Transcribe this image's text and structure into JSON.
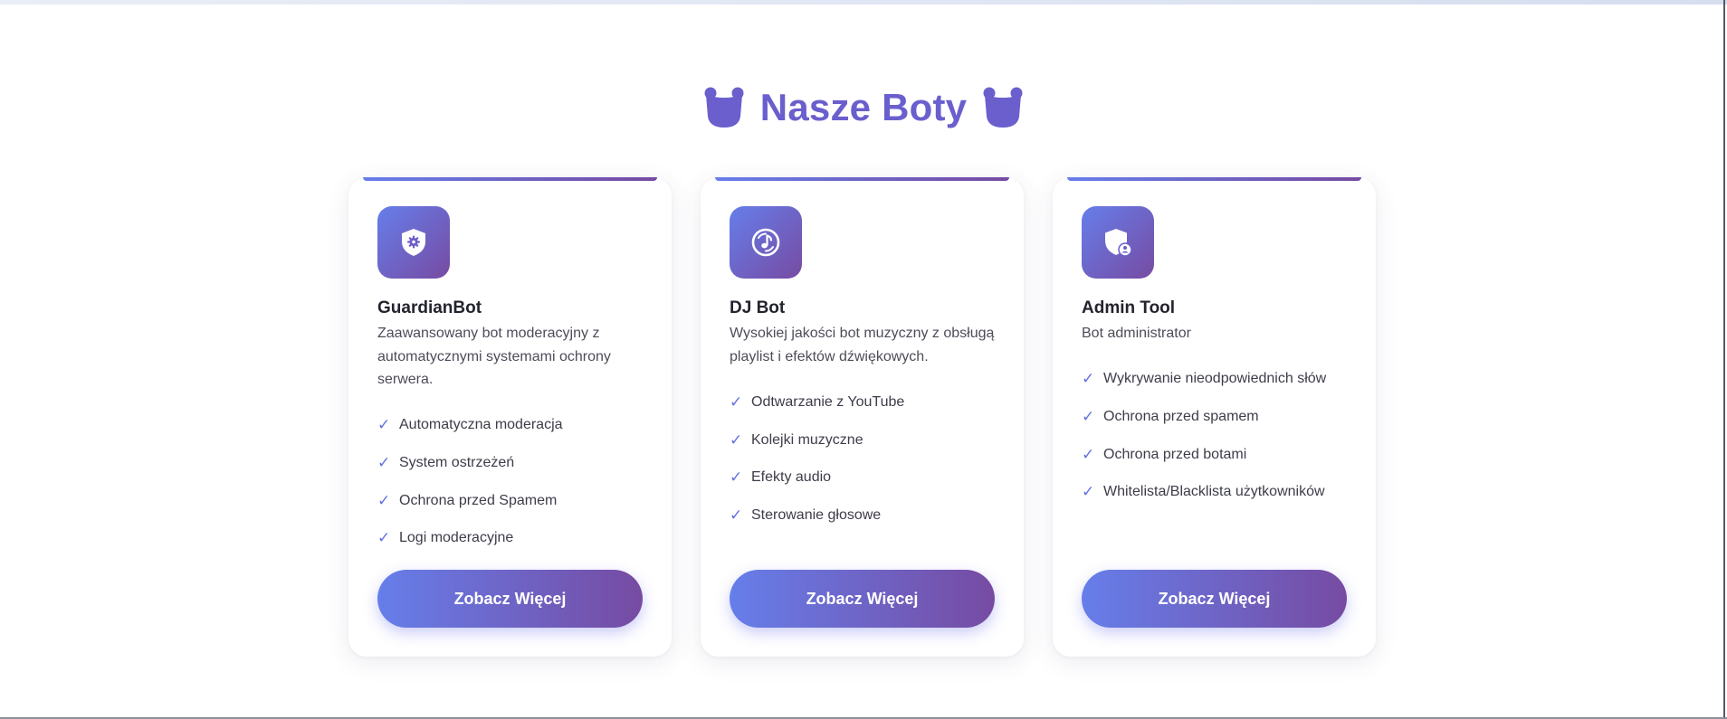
{
  "section": {
    "title": "Nasze Boty"
  },
  "icons": {
    "title_left": "robot-icon",
    "title_right": "robot-icon"
  },
  "colors": {
    "accent_start": "#667eea",
    "accent_end": "#764ba2",
    "title": "#6a5fcd"
  },
  "bots": [
    {
      "icon": "shield-gear-icon",
      "name": "GuardianBot",
      "description": "Zaawansowany bot moderacyjny z automatycznymi systemami ochrony serwera.",
      "features": [
        "Automatyczna moderacja",
        "System ostrzeżeń",
        "Ochrona przed Spamem",
        "Logi moderacyjne"
      ],
      "button": "Zobacz Więcej"
    },
    {
      "icon": "music-disc-icon",
      "name": "DJ Bot",
      "description": "Wysokiej jakości bot muzyczny z obsługą playlist i efektów dźwiękowych.",
      "features": [
        "Odtwarzanie z YouTube",
        "Kolejki muzyczne",
        "Efekty audio",
        "Sterowanie głosowe"
      ],
      "button": "Zobacz Więcej"
    },
    {
      "icon": "shield-user-icon",
      "name": "Admin Tool",
      "description": "Bot administrator",
      "features": [
        "Wykrywanie nieodpowiednich słów",
        "Ochrona przed spamem",
        "Ochrona przed botami",
        "Whitelista/Blacklista użytkowników"
      ],
      "button": "Zobacz Więcej"
    }
  ],
  "check_mark": "✓"
}
